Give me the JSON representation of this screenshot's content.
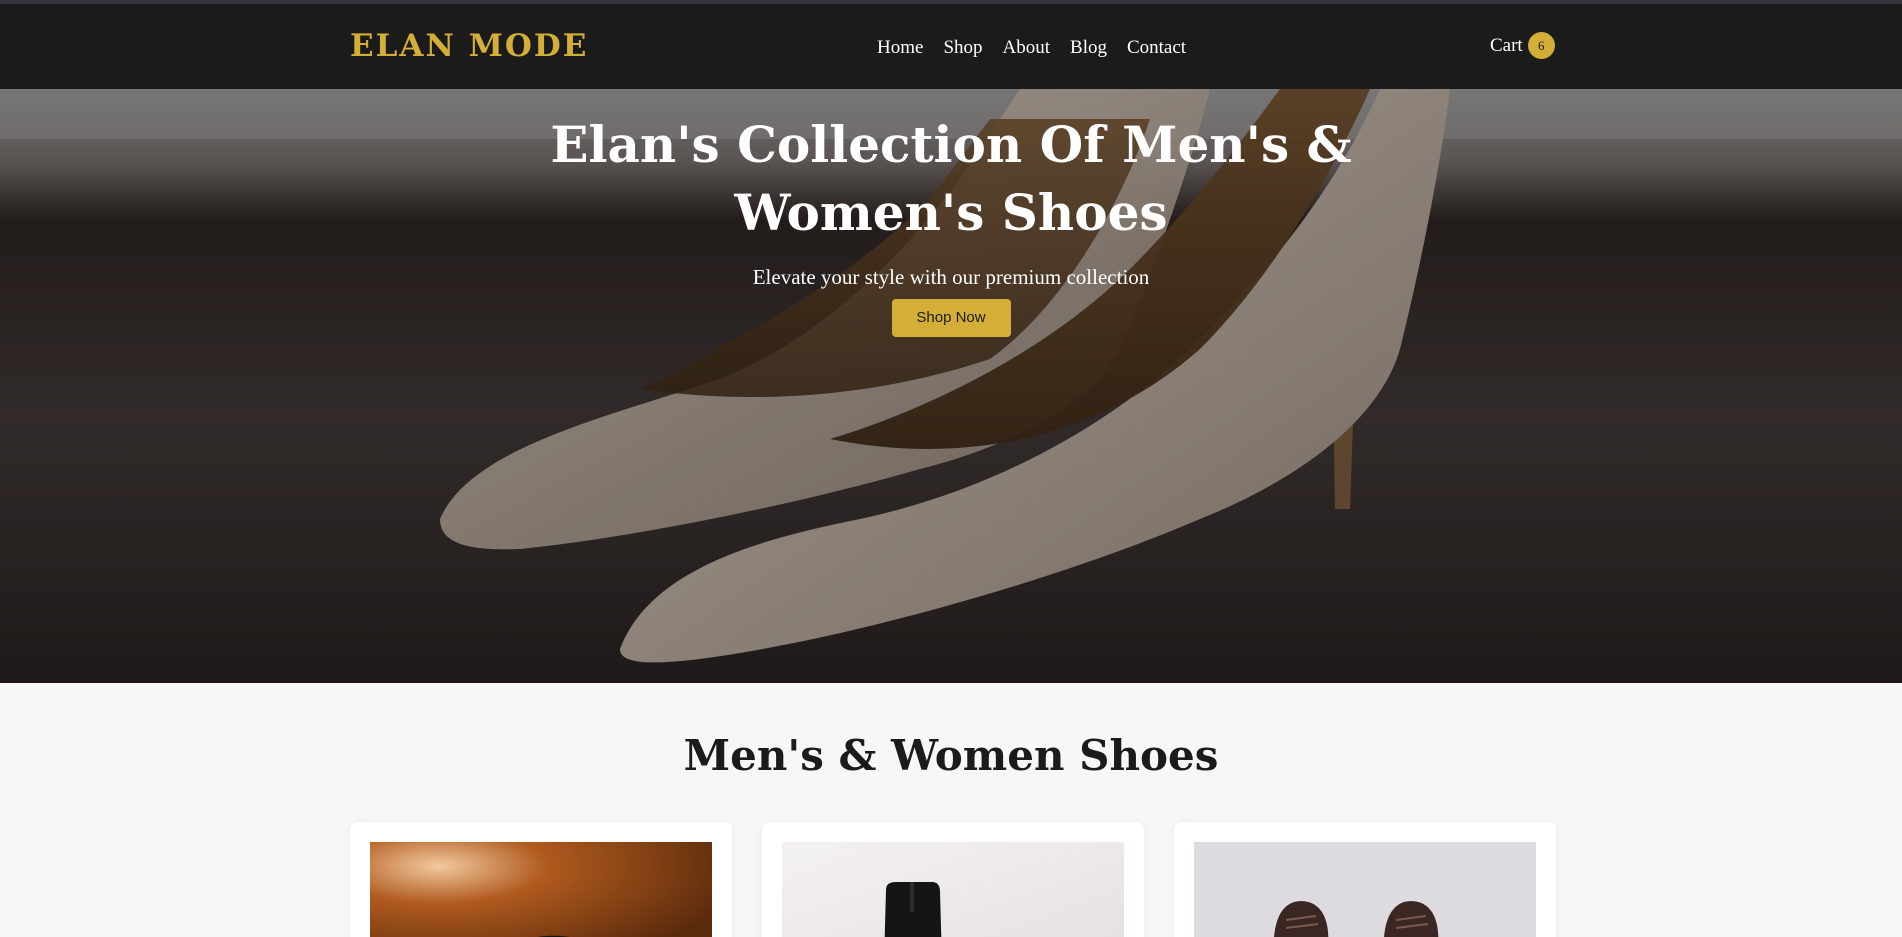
{
  "brand": {
    "logo_text": "ELAN MODE",
    "accent_color": "#d4af37",
    "nav_bg": "#1b1b1b"
  },
  "nav": {
    "links": [
      {
        "label": "Home"
      },
      {
        "label": "Shop"
      },
      {
        "label": "About"
      },
      {
        "label": "Blog"
      },
      {
        "label": "Contact"
      }
    ],
    "cart": {
      "label": "Cart",
      "count": "6"
    }
  },
  "hero": {
    "title": "Elan's Collection Of Men's & Women's Shoes",
    "subtitle": "Elevate your style with our premium collection",
    "cta_label": "Shop Now"
  },
  "products_section": {
    "title": "Men's & Women Shoes",
    "cards": [
      {
        "image": "dark-leather-shoes-photo"
      },
      {
        "image": "black-ankle-boot-photo"
      },
      {
        "image": "brown-lace-up-shoes-photo"
      }
    ]
  }
}
